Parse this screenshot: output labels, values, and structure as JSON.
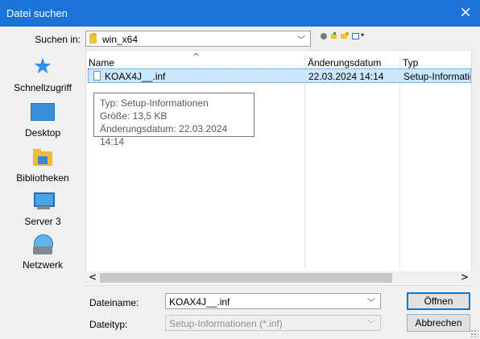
{
  "window": {
    "title": "Datei suchen",
    "close_label": "×"
  },
  "lookin": {
    "label": "Suchen in:",
    "value": "win_x64",
    "icon": "folder-icon"
  },
  "toolbar": {
    "icons": [
      "back-icon",
      "up-folder-icon",
      "new-folder-icon",
      "view-menu-icon"
    ],
    "view_dropdown_glyph": "▾"
  },
  "places": [
    {
      "label": "Schnellzugriff",
      "icon": "star-icon"
    },
    {
      "label": "Desktop",
      "icon": "desktop-icon"
    },
    {
      "label": "Bibliotheken",
      "icon": "libraries-icon"
    },
    {
      "label": "Server 3",
      "icon": "computer-icon"
    },
    {
      "label": "Netzwerk",
      "icon": "network-icon"
    }
  ],
  "filelist": {
    "columns": [
      "Name",
      "Änderungsdatum",
      "Typ"
    ],
    "sort_indicator": "^",
    "rows": [
      {
        "name": "KOAX4J__.inf",
        "date": "22.03.2024 14:14",
        "type": "Setup-Informationen",
        "selected": true
      }
    ]
  },
  "tooltip": {
    "lines": [
      "Typ: Setup-Informationen",
      "Größe: 13,5 KB",
      "Änderungsdatum: 22.03.2024 14:14"
    ]
  },
  "scrollbar": {
    "left": "<",
    "right": ">"
  },
  "form": {
    "filename_label": "Dateiname:",
    "filename_value": "KOAX4J__.inf",
    "filetype_label": "Dateityp:",
    "filetype_value": "Setup-Informationen (*.inf)",
    "open_label": "Öffnen",
    "cancel_label": "Abbrechen"
  },
  "colors": {
    "titlebar": "#1a73d9",
    "selection": "#cce8ff",
    "accent": "#0078d7"
  }
}
